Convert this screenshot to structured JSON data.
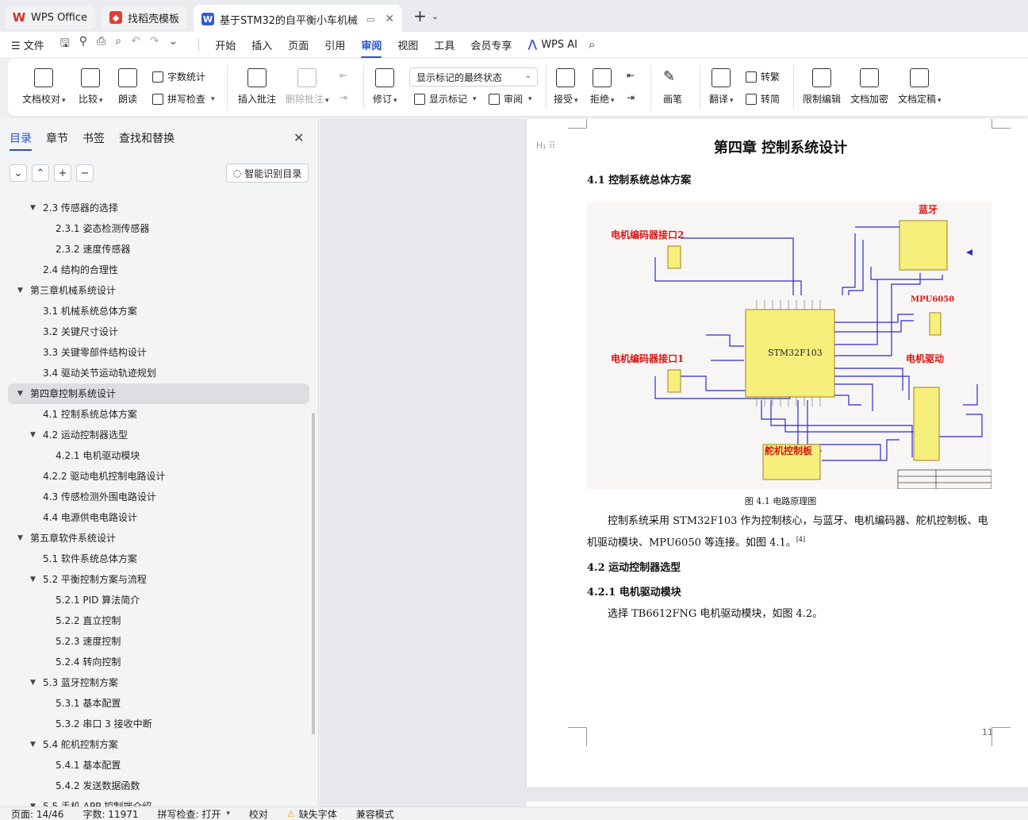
{
  "tabs": [
    {
      "label": "WPS Office",
      "icon": "wps-logo-icon"
    },
    {
      "label": "找稻壳模板",
      "icon": "docer-icon"
    },
    {
      "label": "基于STM32的自平衡小车机械",
      "icon": "word-doc-icon",
      "active": true
    }
  ],
  "menu": {
    "file": "文件",
    "items": [
      "开始",
      "插入",
      "页面",
      "引用",
      "审阅",
      "视图",
      "工具",
      "会员专享"
    ],
    "active": "审阅",
    "wps_ai": "WPS AI"
  },
  "ribbon": {
    "doc_check": "文档校对",
    "compare": "比较",
    "read_aloud": "朗读",
    "word_count": "字数统计",
    "spell_check": "拼写检查",
    "insert_comment": "插入批注",
    "delete_comment": "删除批注",
    "revise": "修订",
    "markup_select": "显示标记的最终状态",
    "show_markup": "显示标记",
    "review": "审阅",
    "accept": "接受",
    "reject": "拒绝",
    "pen": "画笔",
    "translate": "翻译",
    "to_traditional": "转繁",
    "to_simplified": "转简",
    "restrict_edit": "限制编辑",
    "encrypt": "文档加密",
    "finalize": "文档定稿"
  },
  "sidebar": {
    "tabs": [
      "目录",
      "章节",
      "书签",
      "查找和替换"
    ],
    "active_tab": "目录",
    "smart_button": "智能识别目录",
    "toc": [
      {
        "text": "2.3  传感器的选择",
        "level": 2,
        "expand": true
      },
      {
        "text": "2.3.1  姿态检测传感器",
        "level": 3
      },
      {
        "text": "2.3.2  速度传感器",
        "level": 3
      },
      {
        "text": "2.4  结构的合理性",
        "level": 2
      },
      {
        "text": "第三章机械系统设计",
        "level": 1,
        "expand": true
      },
      {
        "text": "3.1  机械系统总体方案",
        "level": 2
      },
      {
        "text": "3.2  关键尺寸设计",
        "level": 2
      },
      {
        "text": "3.3  关键零部件结构设计",
        "level": 2
      },
      {
        "text": "3.4  驱动关节运动轨迹规划",
        "level": 2
      },
      {
        "text": "第四章控制系统设计",
        "level": 1,
        "expand": true,
        "selected": true
      },
      {
        "text": "4.1  控制系统总体方案",
        "level": 2
      },
      {
        "text": "4.2  运动控制器选型",
        "level": 2,
        "expand": true
      },
      {
        "text": "4.2.1  电机驱动模块",
        "level": 3
      },
      {
        "text": "4.2.2  驱动电机控制电路设计",
        "level": 2
      },
      {
        "text": "4.3  传感检测外围电路设计",
        "level": 2
      },
      {
        "text": "4.4  电源供电电路设计",
        "level": 2
      },
      {
        "text": "第五章软件系统设计",
        "level": 1,
        "expand": true
      },
      {
        "text": "5.1  软件系统总体方案",
        "level": 2
      },
      {
        "text": "5.2  平衡控制方案与流程",
        "level": 2,
        "expand": true
      },
      {
        "text": "5.2.1 PID 算法简介",
        "level": 3
      },
      {
        "text": "5.2.2  直立控制",
        "level": 3
      },
      {
        "text": "5.2.3  速度控制",
        "level": 3
      },
      {
        "text": "5.2.4  转向控制",
        "level": 3
      },
      {
        "text": "5.3  蓝牙控制方案",
        "level": 2,
        "expand": true
      },
      {
        "text": "5.3.1  基本配置",
        "level": 3
      },
      {
        "text": "5.3.2  串口 3 接收中断",
        "level": 3
      },
      {
        "text": "5.4  舵机控制方案",
        "level": 2,
        "expand": true
      },
      {
        "text": "5.4.1  基本配置",
        "level": 3
      },
      {
        "text": "5.4.2  发送数据函数",
        "level": 3
      },
      {
        "text": "5.5  手机 APP 控制端介绍",
        "level": 2,
        "expand": true
      }
    ]
  },
  "document": {
    "chapter_title": "第四章  控制系统设计",
    "h_4_1": "4.1  控制系统总体方案",
    "schematic": {
      "bluetooth": "蓝牙",
      "encoder2": "电机编码器接口2",
      "mpu": "MPU6050",
      "mcu": "STM32F103",
      "encoder1": "电机编码器接口1",
      "motor_drive": "电机驱动",
      "servo_board": "舵机控制板"
    },
    "caption": "图 4.1  电路原理图",
    "para1_a": "控制系统采用 STM32F103 作为控制核心，与蓝牙、电机编码器、舵机控制板、电机驱动模块、MPU6050 等连接。如图 4.1。",
    "para1_ref": "[4]",
    "h_4_2": "4.2  运动控制器选型",
    "h_4_2_1": "4.2.1  电机驱动模块",
    "para2": "选择 TB6612FNG 电机驱动模块，如图 4.2。",
    "page_number": "11"
  },
  "status": {
    "page": "页面: 14/46",
    "words": "字数: 11971",
    "spell": "拼写检查: 打开",
    "proof": "校对",
    "missing_font": "缺失字体",
    "compat": "兼容模式"
  },
  "colors": {
    "accent": "#2553c9",
    "schematic_label": "#d41818",
    "chip": "#f7ef7c"
  }
}
